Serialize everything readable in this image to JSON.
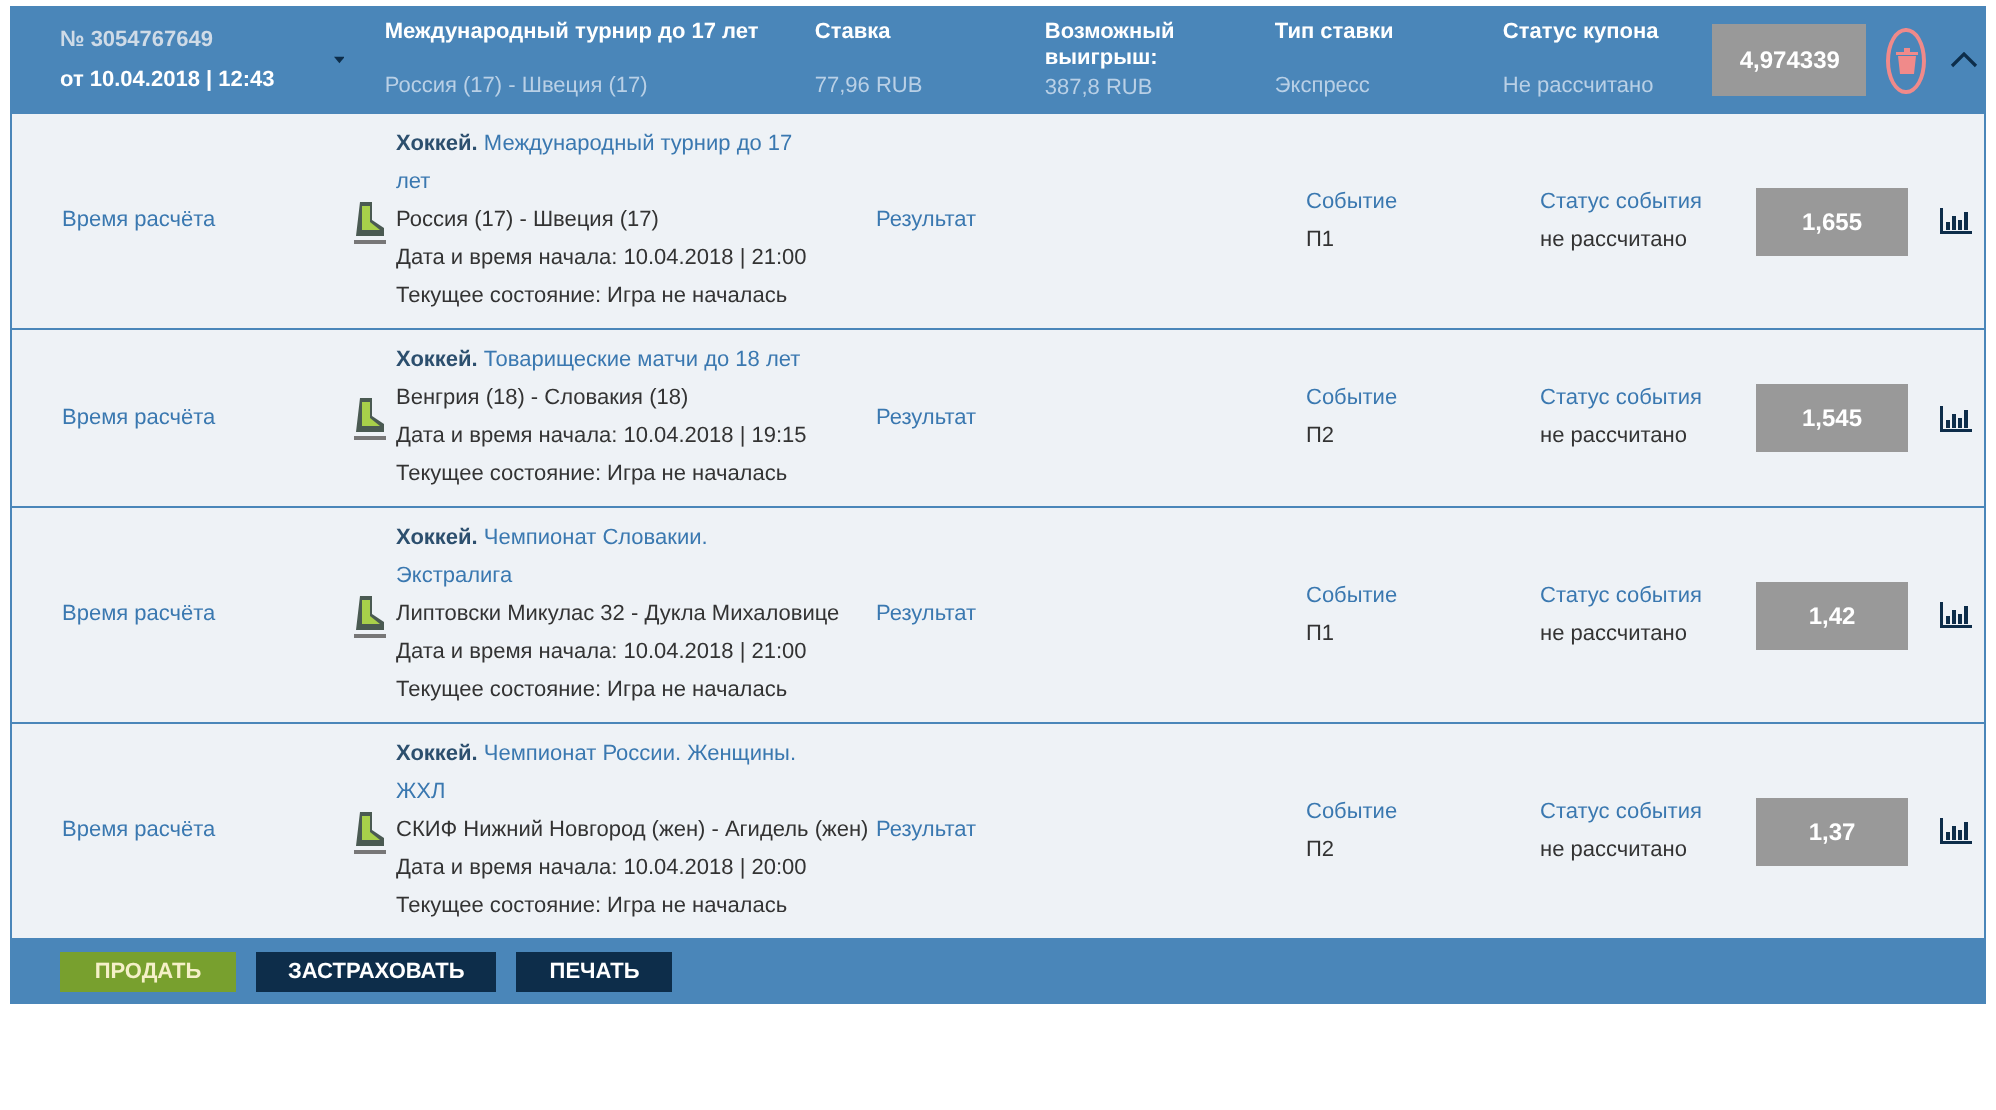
{
  "coupon": {
    "number": "№ 3054767649",
    "date": "от 10.04.2018 | 12:43",
    "tournament": "Международный турнир до 17 лет",
    "match": "Россия (17) - Швеция (17)",
    "stake_label": "Ставка",
    "stake": "77,96 RUB",
    "win_label": "Возможный выигрыш:",
    "win": "387,8 RUB",
    "type_label": "Тип ставки",
    "type": "Экспресс",
    "status_label": "Статус купона",
    "status": "Не рассчитано",
    "odds": "4,974339",
    "expanded": true
  },
  "events": [
    {
      "settle_label": "Время расчёта",
      "sport": "Хоккей.",
      "league": "Международный турнир до 17 лет",
      "teams": "Россия (17) - Швеция (17)",
      "start": "Дата и время начала: 10.04.2018 | 21:00",
      "state": "Текущее состояние: Игра не началась",
      "market": "Результат",
      "outcome_label": "Событие",
      "outcome": "П1",
      "status_label": "Статус события",
      "status": "не рассчитано",
      "odds": "1,655"
    },
    {
      "settle_label": "Время расчёта",
      "sport": "Хоккей.",
      "league": "Товарищеские матчи до 18 лет",
      "teams": "Венгрия (18) - Словакия (18)",
      "start": "Дата и время начала: 10.04.2018 | 19:15",
      "state": "Текущее состояние: Игра не началась",
      "market": "Результат",
      "outcome_label": "Событие",
      "outcome": "П2",
      "status_label": "Статус события",
      "status": "не рассчитано",
      "odds": "1,545"
    },
    {
      "settle_label": "Время расчёта",
      "sport": "Хоккей.",
      "league": "Чемпионат Словакии. Экстралига",
      "teams": "Липтовски Микулас 32 - Дукла Михаловице",
      "start": "Дата и время начала: 10.04.2018 | 21:00",
      "state": "Текущее состояние: Игра не началась",
      "market": "Результат",
      "outcome_label": "Событие",
      "outcome": "П1",
      "status_label": "Статус события",
      "status": "не рассчитано",
      "odds": "1,42"
    },
    {
      "settle_label": "Время расчёта",
      "sport": "Хоккей.",
      "league": "Чемпионат России. Женщины. ЖХЛ",
      "teams": "СКИФ Нижний Новгород (жен) - Агидель (жен)",
      "start": "Дата и время начала: 10.04.2018 | 20:00",
      "state": "Текущее состояние: Игра не началась",
      "market": "Результат",
      "outcome_label": "Событие",
      "outcome": "П2",
      "status_label": "Статус события",
      "status": "не рассчитано",
      "odds": "1,37"
    }
  ],
  "buttons": [
    {
      "label": "ПРОДАТЬ",
      "kind": "primary"
    },
    {
      "label": "ЗАСТРАХОВАТЬ",
      "kind": "dark"
    },
    {
      "label": "ПЕЧАТЬ",
      "kind": "dark"
    }
  ]
}
